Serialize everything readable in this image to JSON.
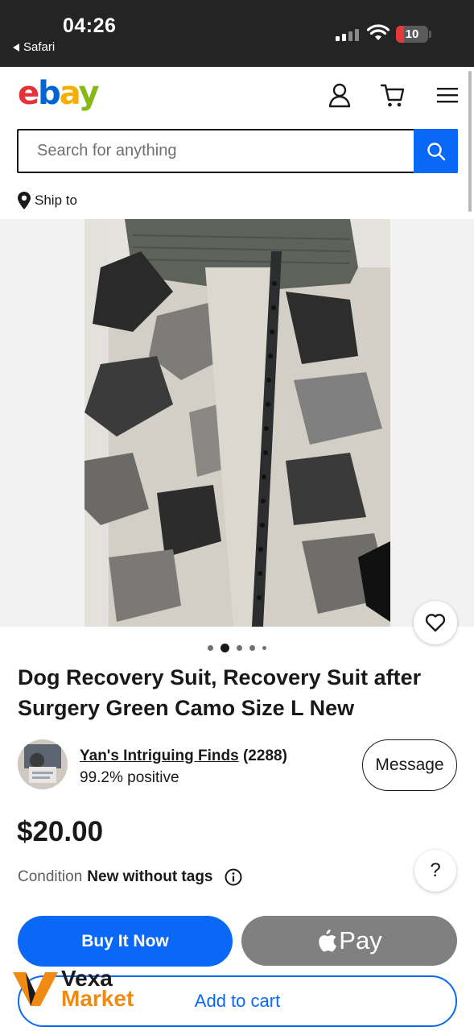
{
  "status_bar": {
    "time": "04:26",
    "back_app": "Safari",
    "battery": "10"
  },
  "header": {
    "logo": {
      "e": "e",
      "b": "b",
      "a": "a",
      "y": "y"
    }
  },
  "search": {
    "placeholder": "Search for anything"
  },
  "ship_to": "Ship to",
  "gallery": {
    "total_images": 5,
    "active_index": 2
  },
  "listing": {
    "title": "Dog Recovery Suit, Recovery Suit after Surgery Green Camo Size L New",
    "price": "$20.00",
    "condition_label": "Condition",
    "condition_value": "New without tags"
  },
  "seller": {
    "name": "Yan's Intriguing Finds",
    "feedback_count": "(2288)",
    "positive": "99.2% positive",
    "message_label": "Message"
  },
  "help_label": "?",
  "actions": {
    "buy_now": "Buy It Now",
    "apple_pay": "Pay",
    "add_to_cart": "Add to cart"
  },
  "watermark": {
    "line1": "Vexa",
    "line2": "Market"
  },
  "colors": {
    "accent_blue": "#0968f6",
    "status_bar": "#242424",
    "apple_pay_gray": "#808080",
    "logo_e": "#e53238",
    "logo_b": "#0064d2",
    "logo_a": "#f5af02",
    "logo_y": "#86b817"
  }
}
